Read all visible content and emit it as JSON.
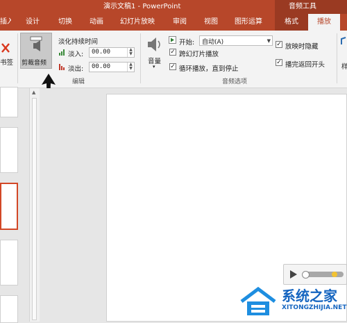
{
  "app": {
    "title": "演示文稿1 - PowerPoint",
    "contextual_group": "音频工具",
    "tab_partial_left": "插入"
  },
  "tabs": [
    {
      "label": "设计"
    },
    {
      "label": "切换"
    },
    {
      "label": "动画"
    },
    {
      "label": "幻灯片放映"
    },
    {
      "label": "审阅"
    },
    {
      "label": "视图"
    },
    {
      "label": "图形运算"
    },
    {
      "label": "格式"
    },
    {
      "label": "播放"
    }
  ],
  "ribbon": {
    "bookmark_partial": "书签",
    "trim_audio": "剪裁音频",
    "fade_title": "淡化持续时间",
    "fade_in_label": "淡入:",
    "fade_in_value": "00.00",
    "fade_out_label": "淡出:",
    "fade_out_value": "00.00",
    "group_edit": "编辑",
    "volume": "音量",
    "start_label": "开始:",
    "start_value": "自动(A)",
    "play_across_slides": "跨幻灯片播放",
    "loop_until_stopped": "循环播放，直到停止",
    "hide_during_show": "放映时隐藏",
    "rewind_after_playing": "播完返回开头",
    "group_audio_options": "音频选项",
    "styles_partial": "样",
    "checks": {
      "play_across_slides": true,
      "loop_until_stopped": true,
      "hide_during_show": true,
      "rewind_after_playing": true
    }
  },
  "player": {
    "play_icon": "play-icon",
    "progress": 0.1
  },
  "watermark": {
    "brand": "系统之家",
    "domain": "XITONGZHIJIA.NET"
  },
  "colors": {
    "accent": "#b7472a",
    "contextual": "#9a3a22",
    "selection": "#d24726"
  }
}
